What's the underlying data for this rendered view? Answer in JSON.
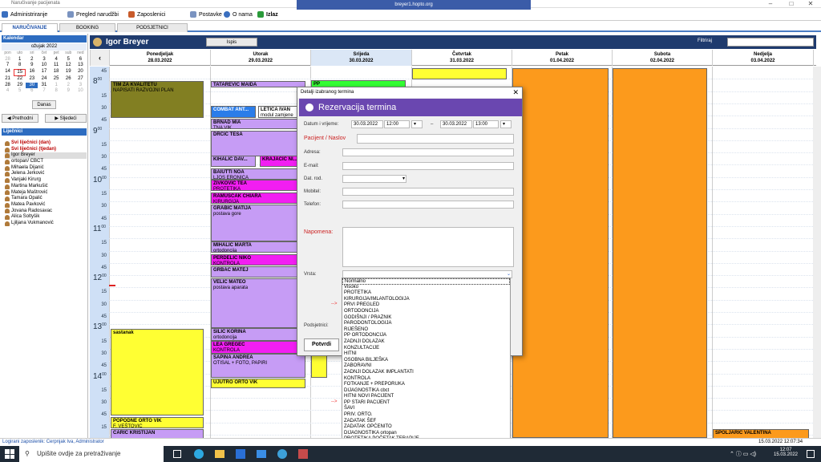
{
  "window": {
    "title": "Naručivanje pacijenata",
    "remote": "breyer1.hopto.org"
  },
  "menu": [
    "Administriranje",
    "Pregled narudžbi",
    "Zaposlenici",
    "Postavke",
    "O nama",
    "Izlaz"
  ],
  "tabs": [
    "NARUČIVANJE",
    "BOOKING",
    "PODSJETNICI"
  ],
  "calendar": {
    "title": "Kalendar",
    "month": "ožujak 2022",
    "dow": [
      "pon",
      "uto",
      "sri",
      "čet",
      "pet",
      "sub",
      "ned"
    ],
    "weeks": [
      [
        "28",
        "1",
        "2",
        "3",
        "4",
        "5",
        "6"
      ],
      [
        "7",
        "8",
        "9",
        "10",
        "11",
        "12",
        "13"
      ],
      [
        "14",
        "15",
        "16",
        "17",
        "18",
        "19",
        "20"
      ],
      [
        "21",
        "22",
        "23",
        "24",
        "25",
        "26",
        "27"
      ],
      [
        "28",
        "29",
        "30",
        "31",
        "1",
        "2",
        "3"
      ],
      [
        "4",
        "5",
        "6",
        "7",
        "8",
        "9",
        "10"
      ]
    ],
    "today_btn": "Danas"
  },
  "nav": {
    "prev": "Prethodni",
    "next": "Sljedeći"
  },
  "doctors_title": "Liječnici",
  "doctors": [
    "Svi liječnici (dan)",
    "Svi liječnici (tjedan)",
    "Igor Breyer",
    "ortopan/ CBCT",
    "Mihaela Dijanić",
    "Jelena Jerković",
    "Vanjaki Kirurg",
    "Martina Markušić",
    "Mateja Maštrović",
    "Tamara Opalić",
    "Matea Pavković",
    "Jovana Radosavac",
    "Alica Soltyšik",
    "Ljiljana Vukmanović"
  ],
  "header": {
    "name": "Igor Breyer",
    "print": "Ispis",
    "filter": "Filtriraj"
  },
  "days": [
    [
      "Ponedjeljak",
      "28.03.2022"
    ],
    [
      "Utorak",
      "29.03.2022"
    ],
    [
      "Srijeda",
      "30.03.2022"
    ],
    [
      "Četvrtak",
      "31.03.2022"
    ],
    [
      "Petak",
      "01.04.2022"
    ],
    [
      "Subota",
      "02.04.2022"
    ],
    [
      "Nedjelja",
      "03.04.2022"
    ]
  ],
  "times": [
    "45",
    "8",
    "15",
    "30",
    "45",
    "9",
    "15",
    "30",
    "45",
    "10",
    "15",
    "30",
    "45",
    "11",
    "15",
    "30",
    "45",
    "12",
    "15",
    "30",
    "45",
    "13",
    "15",
    "30",
    "45",
    "14",
    "15",
    "30",
    "45",
    "15"
  ],
  "events": {
    "mon": [
      [
        "TIM ZA KVALITETU",
        "NAPISATI RAZVOJNI PLAN"
      ],
      [
        "sastanak",
        ""
      ],
      [
        "POPODNE ORTO VIK",
        "F. VEŠTOVIC"
      ],
      [
        "CARIĆ KRISTIJAN",
        ""
      ]
    ],
    "tue": [
      [
        "TATAREVIĆ MAIDA",
        ""
      ],
      [
        "COMBAT ANT...",
        ""
      ],
      [
        "LETICA IVAN",
        "modul zamjene"
      ],
      [
        "BRNAD MIA",
        "TNA VIK"
      ],
      [
        "DRČIĆ TESA",
        ""
      ],
      [
        "KIHALIĆ DAV...",
        ""
      ],
      [
        "KRAJAČIĆ NI...",
        ""
      ],
      [
        "BAIUTTI NOA",
        "LJOS ERONICA"
      ],
      [
        "ŽIVKOVIĆ TEA",
        "PROTETIKA"
      ],
      [
        "RAMUŠČAK CHIARA",
        "KIRURGIJA"
      ],
      [
        "GRABIĆ MATIJA",
        "postava gore"
      ],
      [
        "MIHALIĆ MARTA",
        "ortodoncija"
      ],
      [
        "PERDELIĆ NIKO",
        "KONTROLA"
      ],
      [
        "GRBAC MATEJ",
        ""
      ],
      [
        "VELIĆ MATEO",
        "postava aparata"
      ],
      [
        "SILIĆ KORINA",
        "ortodoncija"
      ],
      [
        "LEA GREGEC",
        "KONTROLA"
      ],
      [
        "ŠAPINA ANDREA",
        "OTISAL + FOTO, PAPIRI"
      ],
      [
        "UJUTRO ORTO VIK",
        ""
      ]
    ],
    "wed": [
      [
        "PP",
        ""
      ]
    ],
    "sun": [
      [
        "ŠPOLJARIĆ VALENTINA",
        ""
      ]
    ]
  },
  "dialog": {
    "title": "Detalji izabranog termina",
    "header": "Rezervacija termina",
    "datetime_label": "Datum i vrijeme:",
    "date_from": "30.03.2022",
    "time_from": "12:00",
    "date_to": "30.03.2022",
    "time_to": "13:00",
    "patient_label": "Pacijent / Naslov",
    "address": "Adresa:",
    "email": "E-mail:",
    "dob": "Dat. rod.",
    "mobile": "Mobitel:",
    "phone": "Telefon:",
    "note": "Napomena:",
    "type": "Vrsta:",
    "reminders": "Podsjetnici:",
    "confirm": "Potvrdi"
  },
  "type_options": [
    "Normalno",
    "Visoko",
    "PROTETIKA",
    "KIRURGIJA/IMLANTOLOGIJA",
    "PRVI PREGLED",
    "ORTODONCIJA",
    "GODIŠNJI / PRAZNIK",
    "PARODONTOLOGIJA",
    "RIJEŠENO",
    "PP ORTODONCIJA",
    "ZADNJI DOLAZAK",
    "KONZULTACIJE",
    "HITNI",
    "OSOBNA BILJEŠKA",
    "ZABORAVNI",
    "ZADNJI DOLAZAK IMPLANTATI",
    "KONTROLA",
    "FOTKANJE + PREPORUKA",
    "DIJAGNOSTIKA cbct",
    "HITNI NOVI PACIJENT",
    "PP STARI PACIJENT",
    "ŠAVI",
    "PRIV. ORTO.",
    "ZADATAK ŠEF",
    "ZADATAK OPĆENITO",
    "DIJAGNOSTIKA ortopan",
    "PROTETIKA POČETAK TERAPIJE",
    "SANACIJA - POČETAK TERAPIJE"
  ],
  "arrows": [
    "-->",
    "-->"
  ],
  "status": {
    "left": "Logirani zaposlenik: Cerpnjak Iva, Administrator",
    "right": "15.03.2022 12:07:34"
  },
  "taskbar": {
    "search": "Upišite ovdje za pretraživanje",
    "time": "12:07",
    "date": "15.03.2022"
  }
}
